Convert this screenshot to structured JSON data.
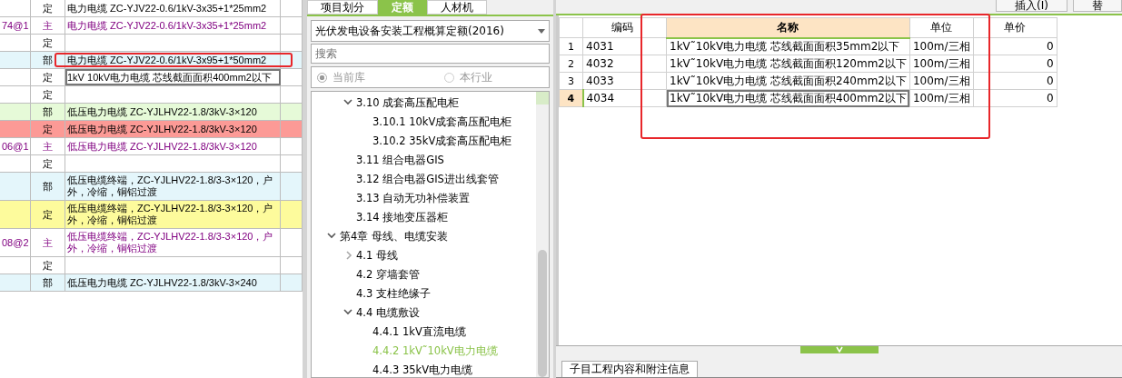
{
  "grid": {
    "rows": [
      {
        "code": "",
        "type": "定",
        "name": "电力电缆 ZC-YJV22-0.6/1kV-3x35+1*25mm2",
        "kind": "normal",
        "color": "#ffffff",
        "editing": false,
        "marked": false
      },
      {
        "code": "74@1",
        "type": "主",
        "name": "电力电缆 ZC-YJV22-0.6/1kV-3x35+1*25mm2",
        "kind": "material",
        "color": "#ffffff",
        "editing": false,
        "marked": false
      },
      {
        "code": "",
        "type": "定",
        "name": "",
        "kind": "normal",
        "color": "#ffffff",
        "editing": false,
        "marked": false
      },
      {
        "code": "",
        "type": "部",
        "name": "电力电缆 ZC-YJV22-0.6/1kV-3x95+1*50mm2",
        "kind": "normal",
        "color": "#e4f6fb",
        "editing": false,
        "marked": true
      },
      {
        "code": "",
        "type": "定",
        "name": "1kV 10kV电力电缆 芯线截面面积400mm2以下",
        "kind": "normal",
        "color": "#ffffff",
        "editing": true,
        "marked": false
      },
      {
        "code": "",
        "type": "定",
        "name": "",
        "kind": "normal",
        "color": "#ffffff",
        "editing": false,
        "marked": false
      },
      {
        "code": "",
        "type": "部",
        "name": "低压电力电缆 ZC-YJLHV22-1.8/3kV-3×120",
        "kind": "normal",
        "color": "#e6fad8",
        "editing": false,
        "marked": false
      },
      {
        "code": "",
        "type": "定",
        "name": "低压电力电缆 ZC-YJLHV22-1.8/3kV-3×120",
        "kind": "normal",
        "color": "#fc9a96",
        "editing": false,
        "marked": false
      },
      {
        "code": "06@1",
        "type": "主",
        "name": "低压电力电缆 ZC-YJLHV22-1.8/3kV-3×120",
        "kind": "material",
        "color": "#ffffff",
        "editing": false,
        "marked": false
      },
      {
        "code": "",
        "type": "定",
        "name": "",
        "kind": "normal",
        "color": "#ffffff",
        "editing": false,
        "marked": false
      },
      {
        "code": "",
        "type": "部",
        "name": "低压电缆终端，ZC-YJLHV22-1.8/3-3×120，户外，冷缩，铜铝过渡",
        "kind": "normal",
        "color": "#e4f6fb",
        "editing": false,
        "marked": false
      },
      {
        "code": "",
        "type": "定",
        "name": "低压电缆终端，ZC-YJLHV22-1.8/3-3×120，户外，冷缩，铜铝过渡",
        "kind": "normal",
        "color": "#fdfb9c",
        "editing": false,
        "marked": false
      },
      {
        "code": "08@2",
        "type": "主",
        "name": "低压电缆终端，ZC-YJLHV22-1.8/3-3×120，户外，冷缩，铜铝过渡",
        "kind": "material",
        "color": "#ffffff",
        "editing": false,
        "marked": false
      },
      {
        "code": "",
        "type": "定",
        "name": "",
        "kind": "normal",
        "color": "#ffffff",
        "editing": false,
        "marked": false
      },
      {
        "code": "",
        "type": "部",
        "name": "低压电力电缆 ZC-YJLHV22-1.8/3kV-3×240",
        "kind": "normal",
        "color": "#e4f6fb",
        "editing": false,
        "marked": false
      }
    ]
  },
  "library": {
    "tabs": [
      {
        "label": "项目划分",
        "selected": false
      },
      {
        "label": "定额",
        "selected": true
      },
      {
        "label": "人材机",
        "selected": false
      }
    ],
    "dropdown": "光伏发电设备安装工程概算定额(2016)",
    "search": {
      "placeholder": "搜索"
    },
    "scope": [
      {
        "label": "当前库",
        "selected": true,
        "disabled": true
      },
      {
        "label": "本行业",
        "selected": false,
        "disabled": true
      }
    ],
    "tree": [
      {
        "children": [
          {
            "label": "3.10 成套高压配电柜",
            "expanded": true,
            "selected": false,
            "children": [
              {
                "label": "3.10.1 10kV成套高压配电柜",
                "selected": false
              },
              {
                "label": "3.10.2 35kV成套高压配电柜",
                "selected": false
              }
            ]
          },
          {
            "label": "3.11 组合电器GIS",
            "selected": false
          },
          {
            "label": "3.12 组合电器GIS进出线套管",
            "selected": false
          },
          {
            "label": "3.13 自动无功补偿装置",
            "selected": false
          },
          {
            "label": "3.14 接地变压器柜",
            "selected": false
          }
        ]
      },
      {
        "label": "第4章 母线、电缆安装",
        "expanded": true,
        "selected": false,
        "children": [
          {
            "label": "4.1 母线",
            "expanded": false,
            "selected": false
          },
          {
            "label": "4.2 穿墙套管",
            "selected": false
          },
          {
            "label": "4.3 支柱绝缘子",
            "selected": false
          },
          {
            "label": "4.4 电缆敷设",
            "expanded": true,
            "selected": false,
            "children": [
              {
                "label": "4.4.1 1kV直流电缆",
                "selected": false
              },
              {
                "label": "4.4.2 1kV˜10kV电力电缆",
                "selected": true
              },
              {
                "label": "4.4.3 35kV电力电缆",
                "selected": false
              }
            ]
          }
        ]
      }
    ]
  },
  "toolbar": {
    "buttons": [
      "插入(I)",
      "替"
    ]
  },
  "quota_table": {
    "columns": [
      {
        "label": "编码",
        "selected": false
      },
      {
        "label": "名称",
        "selected": true
      },
      {
        "label": "单位",
        "selected": false
      },
      {
        "label": "单价",
        "selected": false
      }
    ],
    "rows": [
      {
        "index": "1",
        "code": "4031",
        "name": "1kV˜10kV电力电缆 芯线截面面积35mm2以下",
        "unit": "100m/三相",
        "price": "0",
        "selected": false
      },
      {
        "index": "2",
        "code": "4032",
        "name": "1kV˜10kV电力电缆 芯线截面面积120mm2以下",
        "unit": "100m/三相",
        "price": "0",
        "selected": false
      },
      {
        "index": "3",
        "code": "4033",
        "name": "1kV˜10kV电力电缆 芯线截面面积240mm2以下",
        "unit": "100m/三相",
        "price": "0",
        "selected": false
      },
      {
        "index": "4",
        "code": "4034",
        "name": "1kV˜10kV电力电缆 芯线截面面积400mm2以下",
        "unit": "100m/三相",
        "price": "0",
        "selected": true
      }
    ]
  },
  "bottom_tabs": [
    {
      "label": "子目工程内容和附注信息",
      "selected": true
    }
  ]
}
